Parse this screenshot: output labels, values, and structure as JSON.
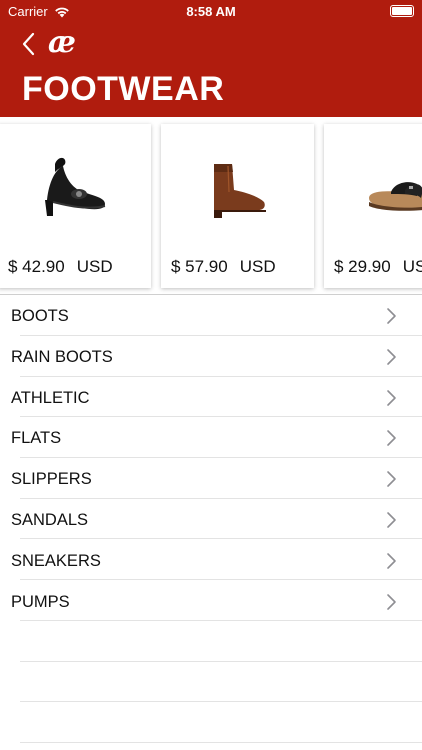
{
  "status_bar": {
    "carrier": "Carrier",
    "time": "8:58 AM",
    "battery_level": 1.0
  },
  "header": {
    "back_icon": "chevron-left-icon",
    "logo_text": "æ",
    "title": "FOOTWEAR",
    "background_color": "#b01c0e"
  },
  "products": [
    {
      "image": "black-heeled-sandal",
      "price": "$ 42.90",
      "currency": "USD"
    },
    {
      "image": "brown-ankle-boot",
      "price": "$ 57.90",
      "currency": "USD"
    },
    {
      "image": "black-slide-sandal",
      "price": "$ 29.90",
      "currency": "USD"
    }
  ],
  "categories": [
    {
      "label": "BOOTS"
    },
    {
      "label": "RAIN BOOTS"
    },
    {
      "label": "ATHLETIC"
    },
    {
      "label": "FLATS"
    },
    {
      "label": "SLIPPERS"
    },
    {
      "label": "SANDALS"
    },
    {
      "label": "SNEAKERS"
    },
    {
      "label": "PUMPS"
    }
  ]
}
